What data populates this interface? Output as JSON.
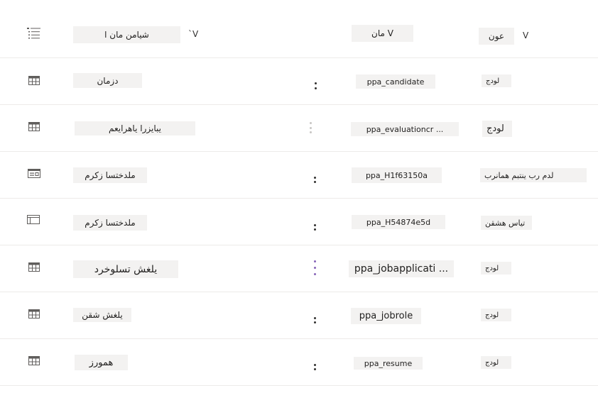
{
  "header": {
    "display_name_label": "شیامن مان ا",
    "display_name_sort": "`V",
    "name_label": "مان V",
    "type_label": "عون",
    "type_sort": "V"
  },
  "rows": [
    {
      "icon": "table-icon",
      "display_name": "دزمان",
      "name": "ppa_candidate",
      "type": "لودج"
    },
    {
      "icon": "table-icon",
      "display_name": "یبایزرا یاهرایعم",
      "name": "ppa_evaluationcr ...",
      "type": "لودج"
    },
    {
      "icon": "card-form-icon",
      "display_name": "ملدختسا زکرم",
      "name": "ppa_H1f63150a",
      "type": "لدم رب ینتبم همانرب"
    },
    {
      "icon": "window-icon",
      "display_name": "ملدختسا زکرم",
      "name": "ppa_H54874e5d",
      "type": "تیاس هشقن"
    },
    {
      "icon": "table-icon",
      "display_name": "یلغش تسلوخرد",
      "name": "ppa_jobapplicati ...",
      "type": "لودج"
    },
    {
      "icon": "table-icon",
      "display_name": "یلغش شقن",
      "name": "ppa_jobrole",
      "type": "لودج"
    },
    {
      "icon": "table-icon",
      "display_name": "همورز",
      "name": "ppa_resume",
      "type": "لودج"
    }
  ]
}
